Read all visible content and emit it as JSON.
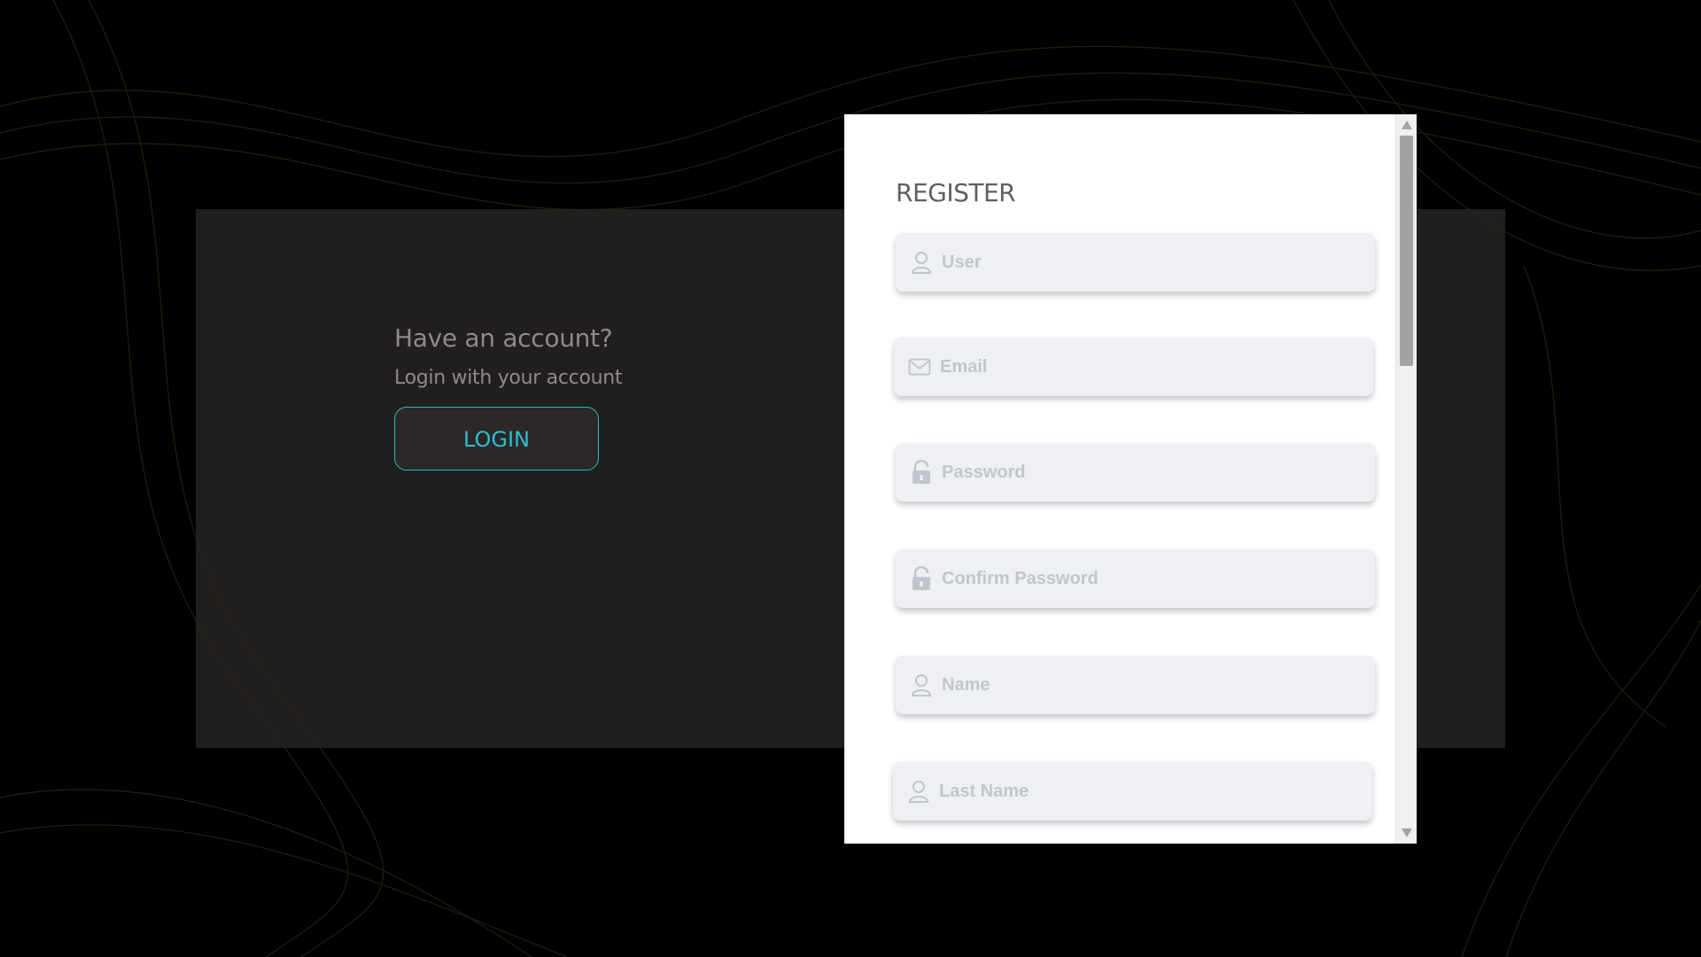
{
  "login": {
    "heading": "Have an account?",
    "subheading": "Login with your account",
    "button_label": "LOGIN",
    "accent_color": "#2bc0cd"
  },
  "register": {
    "title": "REGISTER",
    "fields": [
      {
        "icon": "user-icon",
        "placeholder": "User"
      },
      {
        "icon": "envelope-icon",
        "placeholder": "Email"
      },
      {
        "icon": "unlock-icon",
        "placeholder": "Password"
      },
      {
        "icon": "unlock-icon",
        "placeholder": "Confirm Password"
      },
      {
        "icon": "user-icon",
        "placeholder": "Name"
      },
      {
        "icon": "user-icon",
        "placeholder": "Last Name"
      }
    ]
  },
  "colors": {
    "background": "#000000",
    "wave": "#3a3a10",
    "card": "#282424",
    "field_bg": "#eef0f3",
    "placeholder": "#c2c6cc"
  }
}
